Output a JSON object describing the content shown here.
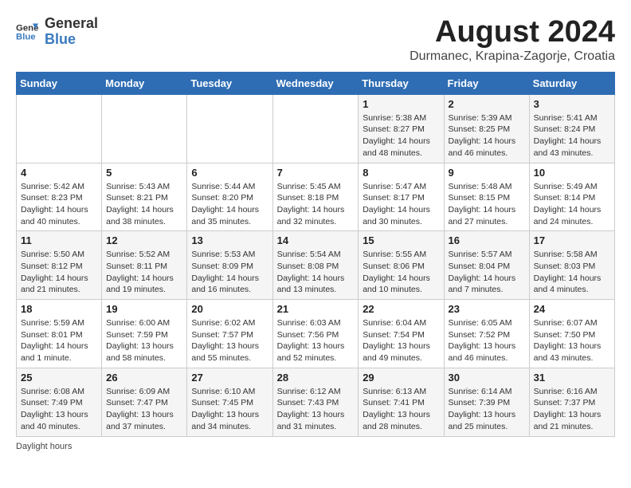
{
  "header": {
    "logo_general": "General",
    "logo_blue": "Blue",
    "month": "August 2024",
    "location": "Durmanec, Krapina-Zagorje, Croatia"
  },
  "weekdays": [
    "Sunday",
    "Monday",
    "Tuesday",
    "Wednesday",
    "Thursday",
    "Friday",
    "Saturday"
  ],
  "weeks": [
    [
      {
        "day": "",
        "info": ""
      },
      {
        "day": "",
        "info": ""
      },
      {
        "day": "",
        "info": ""
      },
      {
        "day": "",
        "info": ""
      },
      {
        "day": "1",
        "info": "Sunrise: 5:38 AM\nSunset: 8:27 PM\nDaylight: 14 hours and 48 minutes."
      },
      {
        "day": "2",
        "info": "Sunrise: 5:39 AM\nSunset: 8:25 PM\nDaylight: 14 hours and 46 minutes."
      },
      {
        "day": "3",
        "info": "Sunrise: 5:41 AM\nSunset: 8:24 PM\nDaylight: 14 hours and 43 minutes."
      }
    ],
    [
      {
        "day": "4",
        "info": "Sunrise: 5:42 AM\nSunset: 8:23 PM\nDaylight: 14 hours and 40 minutes."
      },
      {
        "day": "5",
        "info": "Sunrise: 5:43 AM\nSunset: 8:21 PM\nDaylight: 14 hours and 38 minutes."
      },
      {
        "day": "6",
        "info": "Sunrise: 5:44 AM\nSunset: 8:20 PM\nDaylight: 14 hours and 35 minutes."
      },
      {
        "day": "7",
        "info": "Sunrise: 5:45 AM\nSunset: 8:18 PM\nDaylight: 14 hours and 32 minutes."
      },
      {
        "day": "8",
        "info": "Sunrise: 5:47 AM\nSunset: 8:17 PM\nDaylight: 14 hours and 30 minutes."
      },
      {
        "day": "9",
        "info": "Sunrise: 5:48 AM\nSunset: 8:15 PM\nDaylight: 14 hours and 27 minutes."
      },
      {
        "day": "10",
        "info": "Sunrise: 5:49 AM\nSunset: 8:14 PM\nDaylight: 14 hours and 24 minutes."
      }
    ],
    [
      {
        "day": "11",
        "info": "Sunrise: 5:50 AM\nSunset: 8:12 PM\nDaylight: 14 hours and 21 minutes."
      },
      {
        "day": "12",
        "info": "Sunrise: 5:52 AM\nSunset: 8:11 PM\nDaylight: 14 hours and 19 minutes."
      },
      {
        "day": "13",
        "info": "Sunrise: 5:53 AM\nSunset: 8:09 PM\nDaylight: 14 hours and 16 minutes."
      },
      {
        "day": "14",
        "info": "Sunrise: 5:54 AM\nSunset: 8:08 PM\nDaylight: 14 hours and 13 minutes."
      },
      {
        "day": "15",
        "info": "Sunrise: 5:55 AM\nSunset: 8:06 PM\nDaylight: 14 hours and 10 minutes."
      },
      {
        "day": "16",
        "info": "Sunrise: 5:57 AM\nSunset: 8:04 PM\nDaylight: 14 hours and 7 minutes."
      },
      {
        "day": "17",
        "info": "Sunrise: 5:58 AM\nSunset: 8:03 PM\nDaylight: 14 hours and 4 minutes."
      }
    ],
    [
      {
        "day": "18",
        "info": "Sunrise: 5:59 AM\nSunset: 8:01 PM\nDaylight: 14 hours and 1 minute."
      },
      {
        "day": "19",
        "info": "Sunrise: 6:00 AM\nSunset: 7:59 PM\nDaylight: 13 hours and 58 minutes."
      },
      {
        "day": "20",
        "info": "Sunrise: 6:02 AM\nSunset: 7:57 PM\nDaylight: 13 hours and 55 minutes."
      },
      {
        "day": "21",
        "info": "Sunrise: 6:03 AM\nSunset: 7:56 PM\nDaylight: 13 hours and 52 minutes."
      },
      {
        "day": "22",
        "info": "Sunrise: 6:04 AM\nSunset: 7:54 PM\nDaylight: 13 hours and 49 minutes."
      },
      {
        "day": "23",
        "info": "Sunrise: 6:05 AM\nSunset: 7:52 PM\nDaylight: 13 hours and 46 minutes."
      },
      {
        "day": "24",
        "info": "Sunrise: 6:07 AM\nSunset: 7:50 PM\nDaylight: 13 hours and 43 minutes."
      }
    ],
    [
      {
        "day": "25",
        "info": "Sunrise: 6:08 AM\nSunset: 7:49 PM\nDaylight: 13 hours and 40 minutes."
      },
      {
        "day": "26",
        "info": "Sunrise: 6:09 AM\nSunset: 7:47 PM\nDaylight: 13 hours and 37 minutes."
      },
      {
        "day": "27",
        "info": "Sunrise: 6:10 AM\nSunset: 7:45 PM\nDaylight: 13 hours and 34 minutes."
      },
      {
        "day": "28",
        "info": "Sunrise: 6:12 AM\nSunset: 7:43 PM\nDaylight: 13 hours and 31 minutes."
      },
      {
        "day": "29",
        "info": "Sunrise: 6:13 AM\nSunset: 7:41 PM\nDaylight: 13 hours and 28 minutes."
      },
      {
        "day": "30",
        "info": "Sunrise: 6:14 AM\nSunset: 7:39 PM\nDaylight: 13 hours and 25 minutes."
      },
      {
        "day": "31",
        "info": "Sunrise: 6:16 AM\nSunset: 7:37 PM\nDaylight: 13 hours and 21 minutes."
      }
    ]
  ],
  "footer": "Daylight hours"
}
